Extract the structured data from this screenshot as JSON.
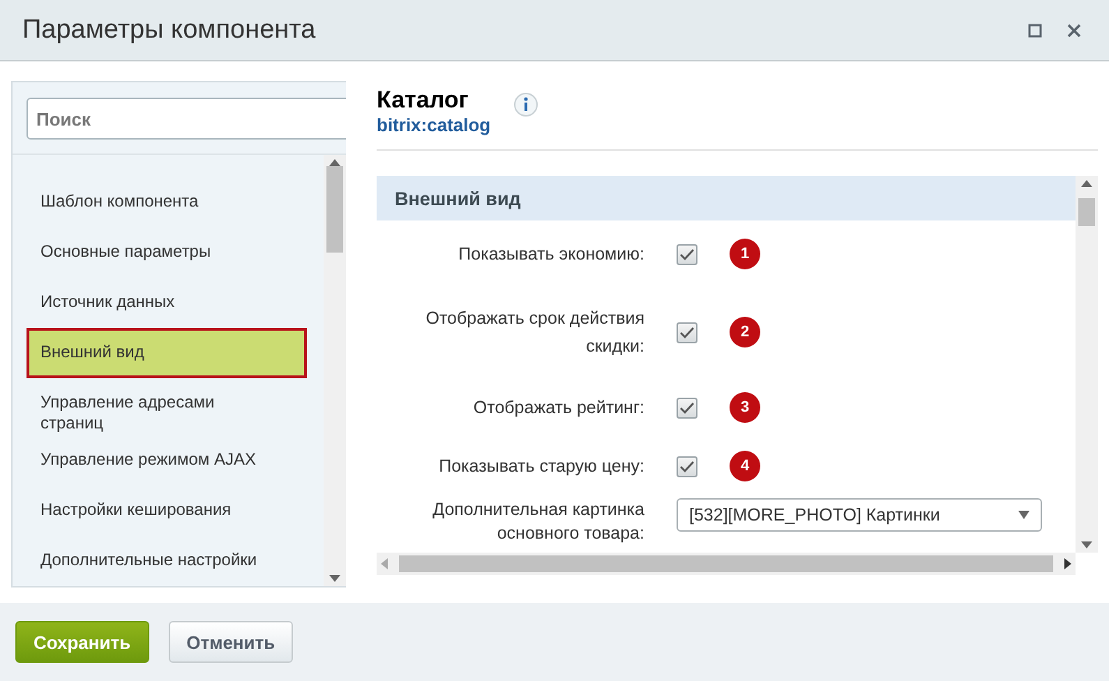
{
  "window": {
    "title": "Параметры компонента"
  },
  "sidebar": {
    "search": {
      "placeholder": "Поиск"
    },
    "items": [
      {
        "label": "Шаблон компонента",
        "selected": false
      },
      {
        "label": "Основные параметры",
        "selected": false
      },
      {
        "label": "Источник данных",
        "selected": false
      },
      {
        "label": "Внешний вид",
        "selected": true
      },
      {
        "label": "Управление адресами страниц",
        "selected": false
      },
      {
        "label": "Управление режимом AJAX",
        "selected": false
      },
      {
        "label": "Настройки кеширования",
        "selected": false
      },
      {
        "label": "Дополнительные настройки",
        "selected": false
      }
    ]
  },
  "component": {
    "title": "Каталог",
    "code": "bitrix:catalog"
  },
  "section": {
    "title": "Внешний вид",
    "rows": [
      {
        "kind": "checkbox",
        "label": "Показывать экономию:",
        "checked": true,
        "badge": "1"
      },
      {
        "kind": "checkbox",
        "label": "Отображать срок действия скидки:",
        "checked": true,
        "badge": "2"
      },
      {
        "kind": "checkbox",
        "label": "Отображать рейтинг:",
        "checked": true,
        "badge": "3"
      },
      {
        "kind": "checkbox",
        "label": "Показывать старую цену:",
        "checked": true,
        "badge": "4"
      },
      {
        "kind": "select",
        "label": "Дополнительная картинка основного товара:",
        "value": "[532][MORE_PHOTO] Картинки"
      }
    ]
  },
  "buttons": [
    {
      "label": "Сохранить",
      "kind": "primary"
    },
    {
      "label": "Отменить",
      "kind": "secondary"
    }
  ]
}
